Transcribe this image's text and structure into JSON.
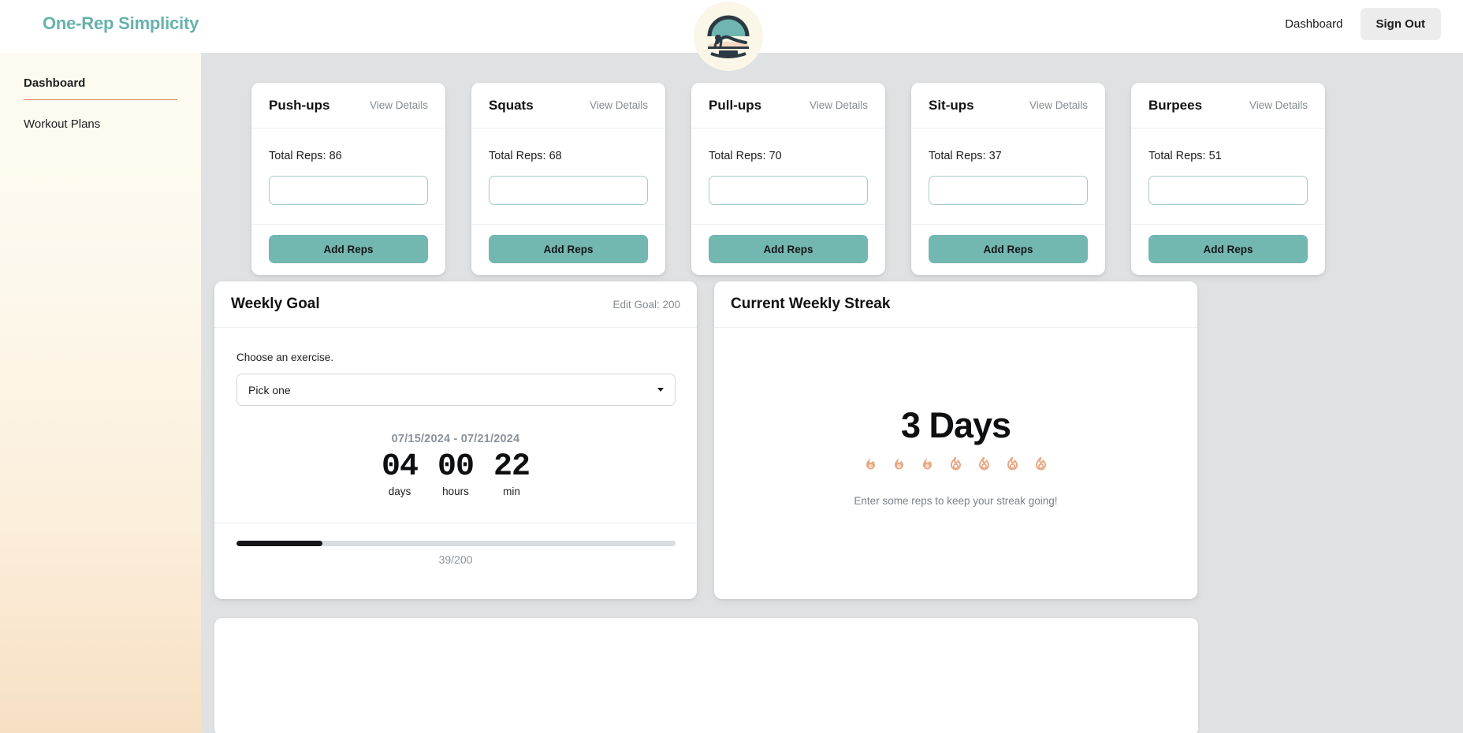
{
  "header": {
    "brand": "One-Rep Simplicity",
    "nav_dashboard": "Dashboard",
    "sign_out": "Sign Out",
    "logo_icon": "pushup-badge-logo",
    "brand_color": "#66b2ab"
  },
  "sidebar": {
    "items": [
      {
        "label": "Dashboard",
        "active": true
      },
      {
        "label": "Workout Plans",
        "active": false
      }
    ],
    "divider_color": "#e08b5c"
  },
  "exercise_cards": [
    {
      "title": "Push-ups",
      "link": "View Details",
      "total_label": "Total Reps: 86",
      "input_value": "",
      "input_placeholder": "",
      "button": "Add Reps"
    },
    {
      "title": "Squats",
      "link": "View Details",
      "total_label": "Total Reps: 68",
      "input_value": "",
      "input_placeholder": "",
      "button": "Add Reps"
    },
    {
      "title": "Pull-ups",
      "link": "View Details",
      "total_label": "Total Reps: 70",
      "input_value": "",
      "input_placeholder": "",
      "button": "Add Reps"
    },
    {
      "title": "Sit-ups",
      "link": "View Details",
      "total_label": "Total Reps: 37",
      "input_value": "",
      "input_placeholder": "",
      "button": "Add Reps"
    },
    {
      "title": "Burpees",
      "link": "View Details",
      "total_label": "Total Reps: 51",
      "input_value": "",
      "input_placeholder": "",
      "button": "Add Reps"
    }
  ],
  "weekly_goal": {
    "title": "Weekly Goal",
    "edit_link": "Edit Goal: 200",
    "choose_label": "Choose an exercise.",
    "select_value": "Pick one",
    "date_range": "07/15/2024 - 07/21/2024",
    "countdown": [
      {
        "value": "04",
        "unit": "days"
      },
      {
        "value": "00",
        "unit": "hours"
      },
      {
        "value": "22",
        "unit": "min"
      }
    ],
    "progress_text": "39/200",
    "progress_percent": 19.5,
    "accent_color": "#73b7b1"
  },
  "streak": {
    "title": "Current Weekly Streak",
    "days": "3 Days",
    "message": "Enter some reps to keep your streak going!",
    "flames_total": 7,
    "flames_filled": 3,
    "flame_color": "#e8a985"
  }
}
